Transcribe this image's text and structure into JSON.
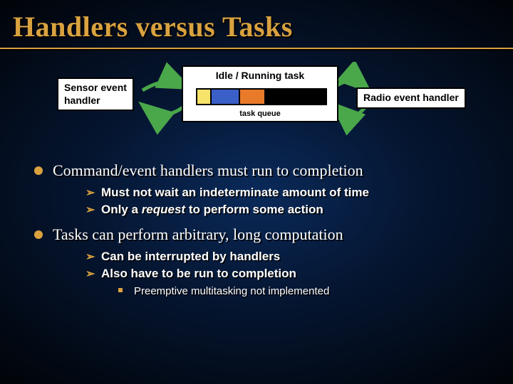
{
  "title": "Handlers versus Tasks",
  "diagram": {
    "sensor_label": "Sensor event\nhandler",
    "idle_label": "Idle / Running task",
    "queue_label": "task queue",
    "radio_label": "Radio event handler"
  },
  "bullets": [
    {
      "text": "Command/event handlers must run to completion",
      "sub": [
        {
          "text": "Must not wait an indeterminate amount of time"
        },
        {
          "text_pre": "Only a ",
          "text_em": "request",
          "text_post": " to perform some action"
        }
      ]
    },
    {
      "text": "Tasks can perform arbitrary, long computation",
      "sub": [
        {
          "text": "Can be interrupted by handlers"
        },
        {
          "text": "Also have to be run to completion",
          "sub3": [
            {
              "text": "Preemptive multitasking not implemented"
            }
          ]
        }
      ]
    }
  ]
}
